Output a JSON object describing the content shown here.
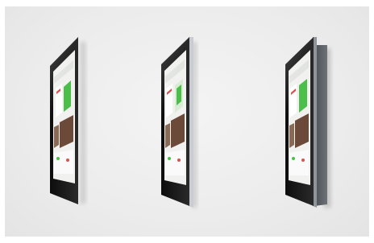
{
  "scene": {
    "background_color": "#ffffff",
    "wall_color": "#ececec",
    "device_count": 3,
    "devices": [
      {
        "mount_style": "flush-thin",
        "frame_color": "#1a1a1a",
        "has_side_trim": false,
        "has_back_box": false
      },
      {
        "mount_style": "silver-edge",
        "frame_color": "#1c1c1c",
        "has_side_trim": true,
        "side_trim_color": "#c9cdd2",
        "has_back_box": false
      },
      {
        "mount_style": "back-box",
        "frame_color": "#1a1a1a",
        "has_side_trim": true,
        "side_trim_color": "#8f959b",
        "has_back_box": true,
        "back_box_color": "#5c6166"
      }
    ],
    "screen_colors": {
      "panel_bg": "#f1f1ef",
      "accent_green": "#4cbf4a",
      "accent_red": "#d9534f",
      "photo_tone": "#6b4a3a"
    }
  }
}
